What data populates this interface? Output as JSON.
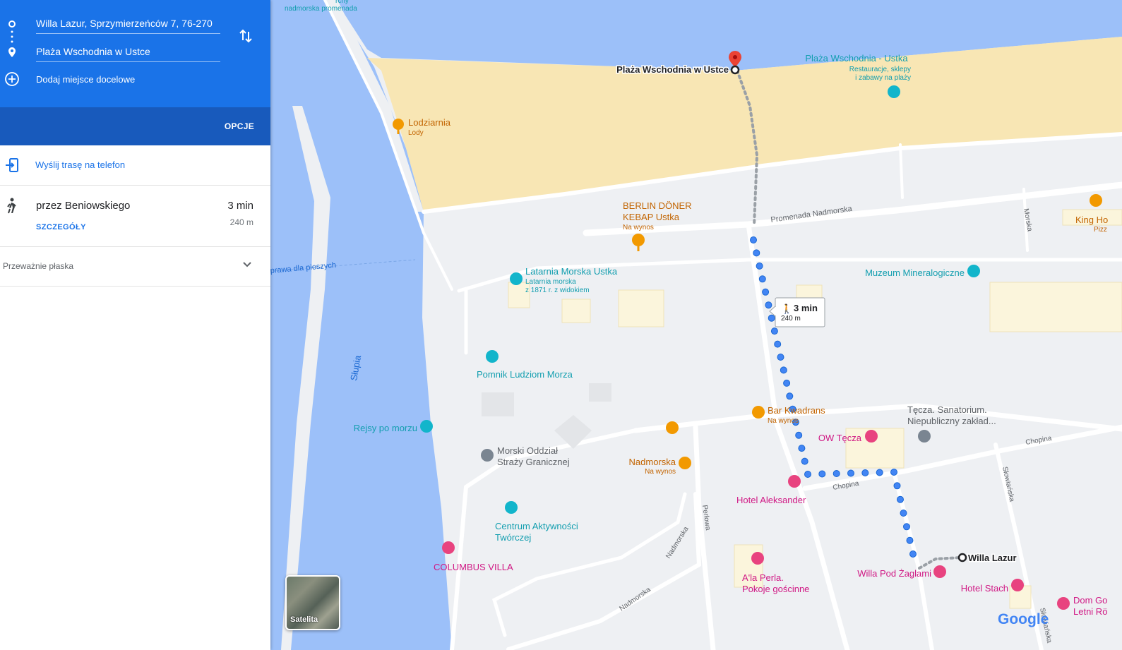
{
  "directions": {
    "origin": "Willa Lazur, Sprzymierzeńców 7, 76-270",
    "destination": "Plaża Wschodnia w Ustce",
    "add_destination": "Dodaj miejsce docelowe",
    "options_label": "OPCJE",
    "send_to_phone": "Wyślij trasę na telefon",
    "route": {
      "via": "przez Beniowskiego",
      "time": "3 min",
      "distance": "240 m",
      "details_label": "SZCZEGÓŁY"
    },
    "terrain": "Przeważnie płaska"
  },
  "map": {
    "water_label": "Słupia",
    "streets": {
      "promenada": "Promenada Nadmorska",
      "morska": "Morska",
      "chopina_1": "Chopina",
      "chopina_2": "Chopina",
      "slowianska_1": "Słowiańska",
      "slowianska_2": "Słowiańska",
      "perlowa": "Perłowa",
      "nadmorska_1": "Nadmorska",
      "nadmorska_2": "Nadmorska",
      "pieszych": "prawa dla pieszych",
      "promenada_top": "nadmorska promenada",
      "top_frag": "rcny"
    },
    "places": {
      "destination_pin": "Plaża Wschodnia w Ustce",
      "plaza_ustka": "Plaża Wschodnia - Ustka",
      "plaza_ustka_sub1": "Restauracje, sklepy",
      "plaza_ustka_sub2": "i zabawy na plaży",
      "lodziarnia": "Lodziarnia",
      "lodziarnia_sub": "Lody",
      "berlin_1": "BERLIN DÖNER",
      "berlin_2": "KEBAP Ustka",
      "berlin_sub": "Na wynos",
      "latarnia": "Latarnia Morska Ustka",
      "latarnia_sub1": "Latarnia morska",
      "latarnia_sub2": "z 1871 r. z widokiem",
      "muzeum": "Muzeum Mineralogiczne",
      "king_1": "King Ho",
      "king_2": "Pizz",
      "pomnik": "Pomnik Ludziom Morza",
      "rejsy": "Rejsy po morzu",
      "bar_kwadrans": "Bar Kwadrans",
      "bar_kwadrans_sub": "Na wynos",
      "tecza_1": "Tęcza. Sanatorium.",
      "tecza_2": "Niepubliczny zakład...",
      "ow_tecza": "OW Tęcza",
      "morski_1": "Morski Oddział",
      "morski_2": "Straży Granicznej",
      "nadmorska_food": "Nadmorska",
      "nadmorska_food_sub": "Na wynos",
      "hotel_aleksander": "Hotel Aleksander",
      "centrum_1": "Centrum Aktywności",
      "centrum_2": "Twórczej",
      "willa_lazur": "Willa Lazur",
      "willa_pod_zaglami": "Willa Pod Żaglami",
      "hotel_stach": "Hotel Stach",
      "dom_1": "Dom Go",
      "dom_2": "Letni Rö",
      "ala_perla_1": "A'la Perla.",
      "ala_perla_2": "Pokoje gościnne",
      "columbus": "COLUMBUS VILLA"
    },
    "route_callout": {
      "time": "3 min",
      "distance": "240 m"
    },
    "satellite_label": "Satelita",
    "google_logo": "Google"
  },
  "colors": {
    "header_blue": "#1a73e8",
    "options_blue": "#185abc",
    "water": "#9cc0f9",
    "beach": "#f8e6b4",
    "route_dot": "#4285f4",
    "food_orange": "#f29900",
    "hotel_pink": "#e8437f",
    "attraction_teal": "#12b5cb",
    "pin_red": "#ea4335"
  }
}
